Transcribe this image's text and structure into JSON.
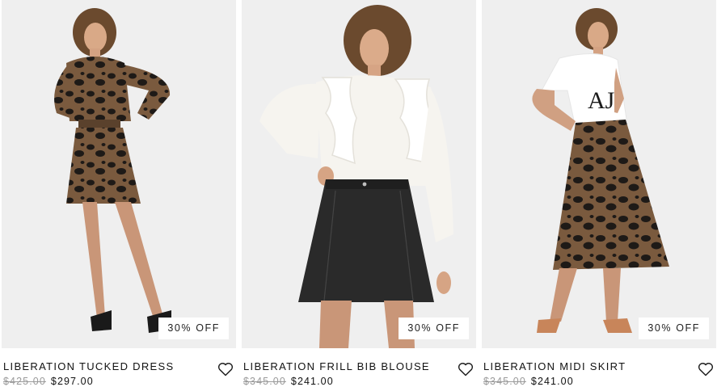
{
  "products": [
    {
      "name": "LIBERATION TUCKED DRESS",
      "was_price": "$425.00",
      "price": "$297.00",
      "badge": "30% OFF"
    },
    {
      "name": "LIBERATION FRILL BIB BLOUSE",
      "was_price": "$345.00",
      "price": "$241.00",
      "badge": "30% OFF"
    },
    {
      "name": "LIBERATION MIDI SKIRT",
      "was_price": "$345.00",
      "price": "$241.00",
      "badge": "30% OFF"
    }
  ],
  "icons": {
    "wishlist": "heart-outline-icon"
  },
  "colors": {
    "photo_bg": "#efefef",
    "text": "#111111",
    "strike": "#9a9a9a",
    "leopard_base": "#7a5a3e",
    "leopard_spot": "#1e1a17",
    "denim": "#2a2a2a"
  }
}
